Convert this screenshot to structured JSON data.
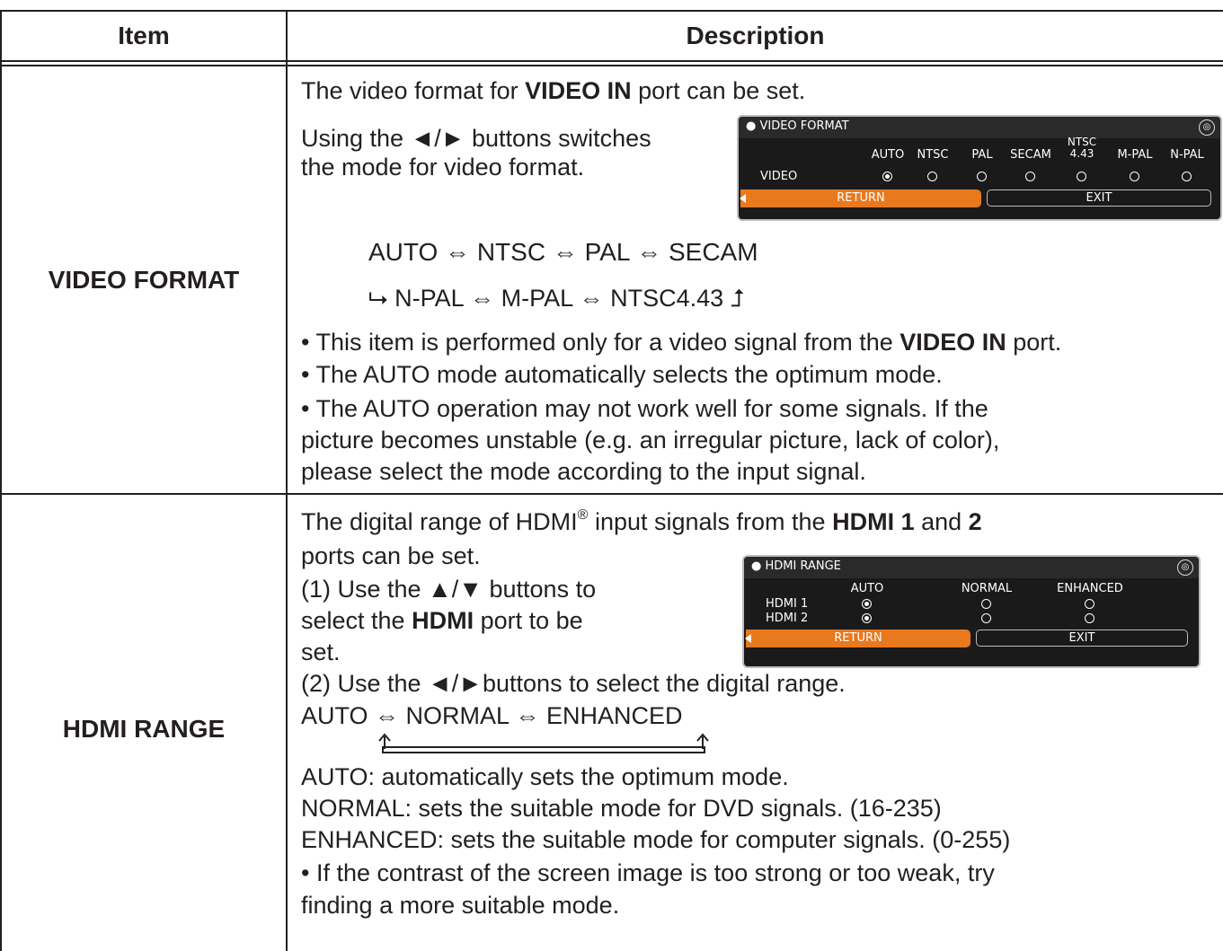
{
  "table": {
    "header": {
      "item": "Item",
      "description": "Description"
    }
  },
  "video_format": {
    "item": "VIDEO FORMAT",
    "line1_pre": "The video format for ",
    "line1_bold": "VIDEO IN",
    "line1_post": " port can be set.",
    "line2": "Using the ◄/► buttons switches",
    "line3": "the mode for video format.",
    "cycle1": "AUTO  ⇔  NTSC  ⇔  PAL  ⇔  SECAM",
    "cycle2": "⮡ N-PAL ⇔ M-PAL ⇔ NTSC4.43 ⮥",
    "note1_pre": "• This item is performed only for a video signal from the ",
    "note1_bold": "VIDEO IN",
    "note1_post": " port.",
    "note2": "• The AUTO mode automatically selects the optimum mode.",
    "note3a": "• The AUTO operation may not work well for some signals. If the",
    "note3b": "picture becomes unstable (e.g. an irregular picture, lack of color),",
    "note3c": "please select the mode according to the input signal.",
    "osd": {
      "title": "VIDEO FORMAT",
      "columns": [
        "AUTO",
        "NTSC",
        "PAL",
        "SECAM",
        "NTSC\n4.43",
        "M-PAL",
        "N-PAL"
      ],
      "row_label": "VIDEO",
      "selected_index": 0,
      "return_label": "RETURN",
      "exit_label": "EXIT"
    }
  },
  "hdmi_range": {
    "item": "HDMI RANGE",
    "line1_pre": "The digital range of HDMI",
    "line1_sup": "®",
    "line1_mid": " input signals from the ",
    "line1_bold1": "HDMI 1",
    "line1_and": " and ",
    "line1_bold2": "2",
    "line2": "ports can be set.",
    "line3": "(1) Use the ▲/▼ buttons to",
    "line4_pre": "select the ",
    "line4_bold": "HDMI",
    "line4_post": " port to be",
    "line5": "set.",
    "line6": "(2) Use the ◄/►buttons to select the digital range.",
    "cycle": "AUTO ⇔ NORMAL ⇔ ENHANCED",
    "desc1": "AUTO: automatically sets the optimum mode.",
    "desc2": "NORMAL: sets the suitable mode for DVD signals. (16-235)",
    "desc3": "ENHANCED: sets the suitable mode for computer signals. (0-255)",
    "note1a": "• If the contrast of the screen image is too strong or too weak, try",
    "note1b": "finding a more suitable mode.",
    "osd": {
      "title": "HDMI RANGE",
      "columns": [
        "AUTO",
        "NORMAL",
        "ENHANCED"
      ],
      "rows": [
        "HDMI 1",
        "HDMI 2"
      ],
      "selected_index": 0,
      "return_label": "RETURN",
      "exit_label": "EXIT"
    }
  }
}
